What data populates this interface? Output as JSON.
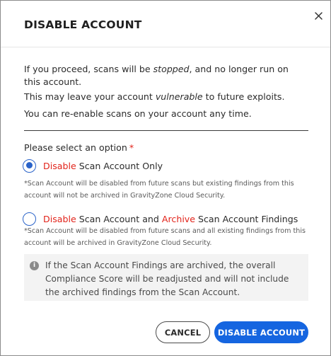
{
  "dialog": {
    "title": "DISABLE ACCOUNT",
    "close_icon": "close-icon"
  },
  "message": {
    "line1_pre": "If you proceed, scans will be ",
    "line1_em": "stopped",
    "line1_post": ", and no longer run on this account.",
    "line2_pre": "This may leave your account ",
    "line2_em": "vulnerable",
    "line2_post": " to future exploits.",
    "line3": "You can re-enable scans on your account any time."
  },
  "options": {
    "label": "Please select an option",
    "required_mark": "*",
    "selected": "option1",
    "option1": {
      "action": "Disable",
      "text": " Scan Account Only",
      "note": "*Scan Account will be disabled from future scans but existing findings from this account will not be archived in GravityZone Cloud Security."
    },
    "option2": {
      "action": "Disable",
      "text_mid": " Scan Account and ",
      "action2": "Archive",
      "text_end": " Scan Account Findings",
      "note": "*Scan Account will be disabled from future scans and all existing findings from this account will be archived in GravityZone Cloud Security."
    }
  },
  "info": {
    "icon": "info-icon",
    "icon_glyph": "i",
    "text": "If the Scan Account Findings are archived, the overall Compliance Score will be readjusted and will not include the archived findings from the Scan Account."
  },
  "buttons": {
    "cancel": "CANCEL",
    "confirm": "DISABLE ACCOUNT"
  },
  "colors": {
    "accent": "#1565e0",
    "danger": "#e2231a",
    "radio": "#2a63c9"
  }
}
